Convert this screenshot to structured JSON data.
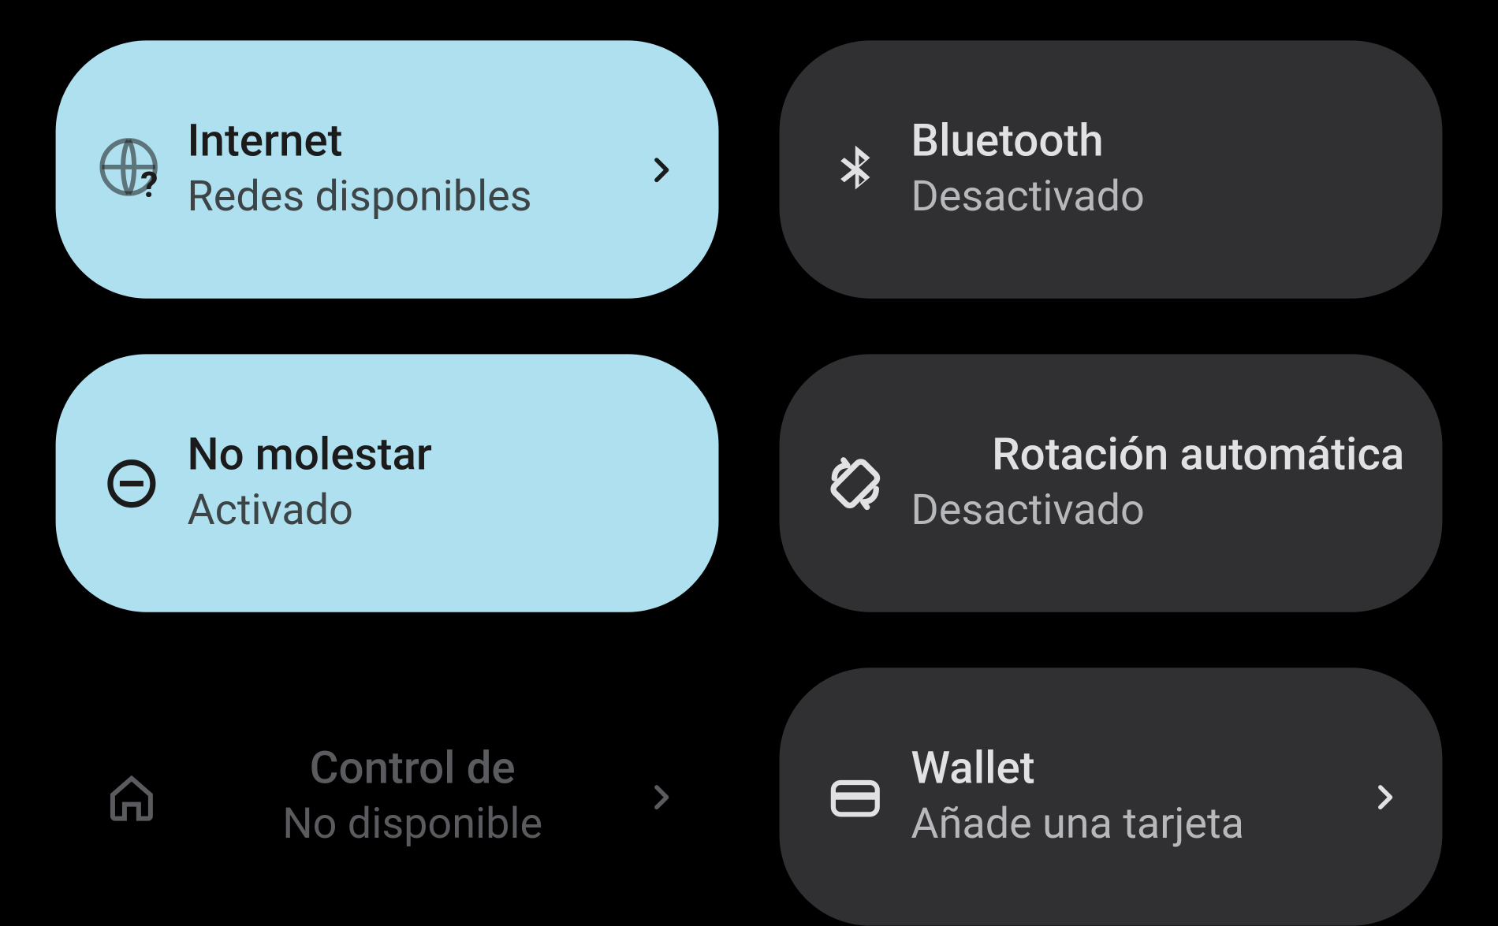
{
  "tiles": {
    "internet": {
      "title": "Internet",
      "sub": "Redes disponibles",
      "active": true,
      "chevron": true
    },
    "bluetooth": {
      "title": "Bluetooth",
      "sub": "Desactivado",
      "active": false,
      "chevron": false
    },
    "dnd": {
      "title": "No molestar",
      "sub": "Activado",
      "active": true,
      "chevron": false
    },
    "rotate": {
      "title": "Rotación automática",
      "sub": "Desactivado",
      "active": false,
      "chevron": false
    },
    "home": {
      "title": "Control de",
      "sub": "No disponible",
      "active": false,
      "chevron": true
    },
    "wallet": {
      "title": "Wallet",
      "sub": "Añade una tarjeta",
      "active": false,
      "chevron": true
    }
  },
  "colors": {
    "activeBg": "#aee0ef",
    "inactiveBg": "#303033",
    "bg": "#000000"
  }
}
